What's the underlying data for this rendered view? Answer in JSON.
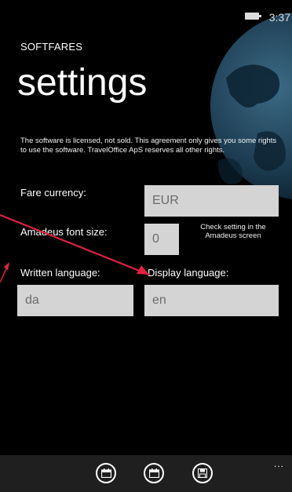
{
  "status_bar": {
    "time": "3:37"
  },
  "header": {
    "app_name": "SOFTFARES",
    "title": "settings"
  },
  "license_text": "The software is licensed, not sold. This agreement only gives you some rights to use the software. TravelOffice ApS reserves all other rights.",
  "form": {
    "fare_currency": {
      "label": "Fare currency:",
      "value": "EUR"
    },
    "amadeus_font_size": {
      "label": "Amadeus font size:",
      "value": "0",
      "hint": "Check setting in the Amadeus screen"
    },
    "written_language": {
      "label": "Written language:",
      "value": "da"
    },
    "display_language": {
      "label": "Display language:",
      "value": "en"
    }
  },
  "app_bar": {
    "buttons": [
      {
        "icon": "calendar-icon"
      },
      {
        "icon": "calendar-icon"
      },
      {
        "icon": "save-icon"
      }
    ],
    "more": "..."
  },
  "colors": {
    "field_bg": "#d4d4d4",
    "arrow": "#e0223f",
    "background": "#000000"
  }
}
